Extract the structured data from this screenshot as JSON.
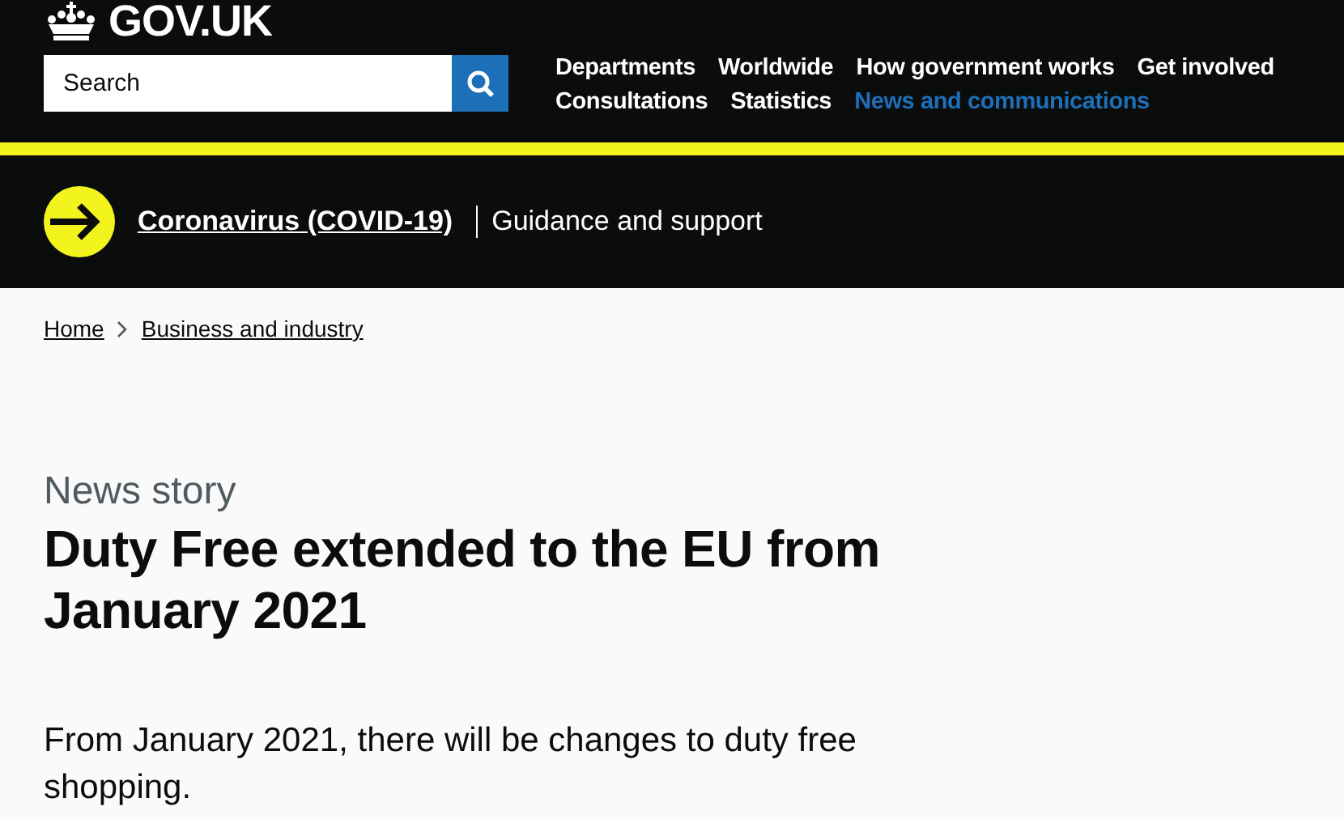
{
  "header": {
    "logo": "GOV.UK",
    "search": {
      "placeholder": "Search"
    },
    "nav": [
      {
        "label": "Departments",
        "selected": false
      },
      {
        "label": "Worldwide",
        "selected": false
      },
      {
        "label": "How government works",
        "selected": false
      },
      {
        "label": "Get involved",
        "selected": false
      },
      {
        "label": "Consultations",
        "selected": false
      },
      {
        "label": "Statistics",
        "selected": false
      },
      {
        "label": "News and communications",
        "selected": true
      }
    ]
  },
  "banner": {
    "link": "Coronavirus (COVID-19)",
    "text": "Guidance and support"
  },
  "breadcrumbs": [
    "Home",
    "Business and industry"
  ],
  "article": {
    "type": "News story",
    "title": "Duty Free extended to the EU from January 2021",
    "summary": "From January 2021, there will be changes to duty free shopping."
  }
}
